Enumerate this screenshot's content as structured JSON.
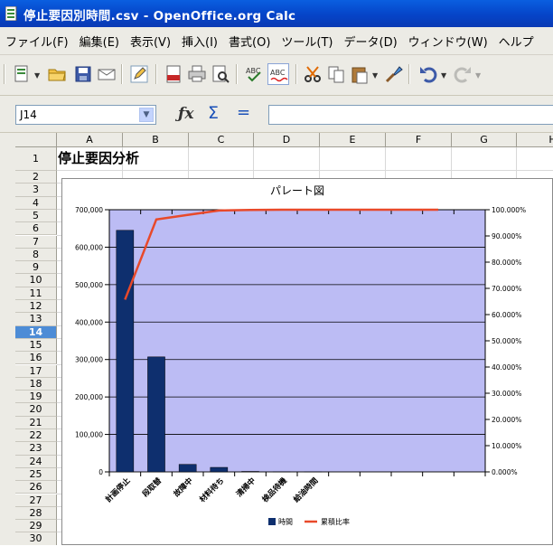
{
  "window": {
    "title": "停止要因別時間.csv - OpenOffice.org Calc"
  },
  "menu": [
    "ファイル(F)",
    "編集(E)",
    "表示(V)",
    "挿入(I)",
    "書式(O)",
    "ツール(T)",
    "データ(D)",
    "ウィンドウ(W)",
    "ヘルプ"
  ],
  "formula_bar": {
    "cell_ref": "J14",
    "formula": ""
  },
  "sheet": {
    "columns": [
      "A",
      "B",
      "C",
      "D",
      "E",
      "F",
      "G",
      "H"
    ],
    "rows": [
      "1",
      "2",
      "3",
      "4",
      "5",
      "6",
      "7",
      "8",
      "9",
      "10",
      "11",
      "12",
      "13",
      "14",
      "15",
      "16",
      "17",
      "18",
      "19",
      "20",
      "21",
      "22",
      "23",
      "24",
      "25",
      "26",
      "27",
      "28",
      "29",
      "30"
    ],
    "active_row": "14",
    "a1": "停止要因分析"
  },
  "chart_data": {
    "type": "bar",
    "title": "パレート図",
    "categories": [
      "計画停止",
      "段取替",
      "故障中",
      "材料待ち",
      "清掃中",
      "検品待機",
      "給油時間"
    ],
    "series": [
      {
        "name": "時間",
        "type": "bar",
        "color": "#0e2f6e",
        "values": [
          645000,
          307000,
          20000,
          12000,
          1200,
          500,
          300
        ]
      },
      {
        "name": "累積比率",
        "type": "line",
        "axis": "right",
        "color": "#e8492a",
        "values": [
          65.7,
          96.3,
          98.0,
          99.7,
          99.9,
          100.0,
          100.0
        ]
      }
    ],
    "y_left": {
      "ticks": [
        "0",
        "100,000",
        "200,000",
        "300,000",
        "400,000",
        "500,000",
        "600,000",
        "700,000"
      ],
      "ylim": [
        0,
        700000
      ]
    },
    "y_right": {
      "ticks": [
        "0.000%",
        "10.000%",
        "20.000%",
        "30.000%",
        "40.000%",
        "50.000%",
        "60.000%",
        "70.000%",
        "80.000%",
        "90.000%",
        "100.000%"
      ],
      "ylim": [
        0,
        100
      ]
    },
    "plot_background": "#bcbcf4",
    "grid": true,
    "legend": "bottom"
  }
}
